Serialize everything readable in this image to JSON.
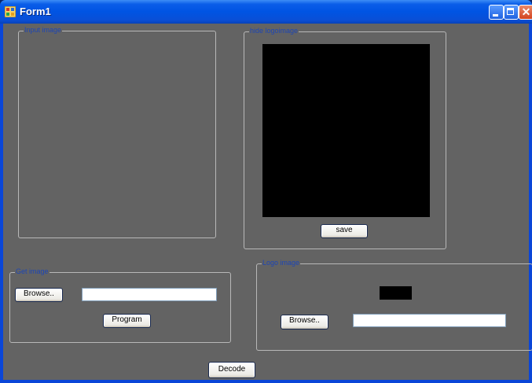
{
  "window": {
    "title": "Form1",
    "icon": "form-app-icon"
  },
  "titlebar": {
    "minimize": "minimize-icon",
    "maximize": "maximize-icon",
    "close_glyph": "✕"
  },
  "groups": {
    "input_image": {
      "label": "Input image"
    },
    "hide_logo_image": {
      "label": "hide logoimage",
      "save_label": "save"
    },
    "get_image": {
      "label": "Get image",
      "browse_label": "Browse..",
      "path_value": "",
      "program_label": "Program"
    },
    "logo_image": {
      "label": "Logo image",
      "browse_label": "Browse..",
      "path_value": ""
    }
  },
  "decode_label": "Decode",
  "colors": {
    "client_bg": "#636363",
    "group_label": "#1e46b4",
    "titlebar": "#0054e3"
  }
}
